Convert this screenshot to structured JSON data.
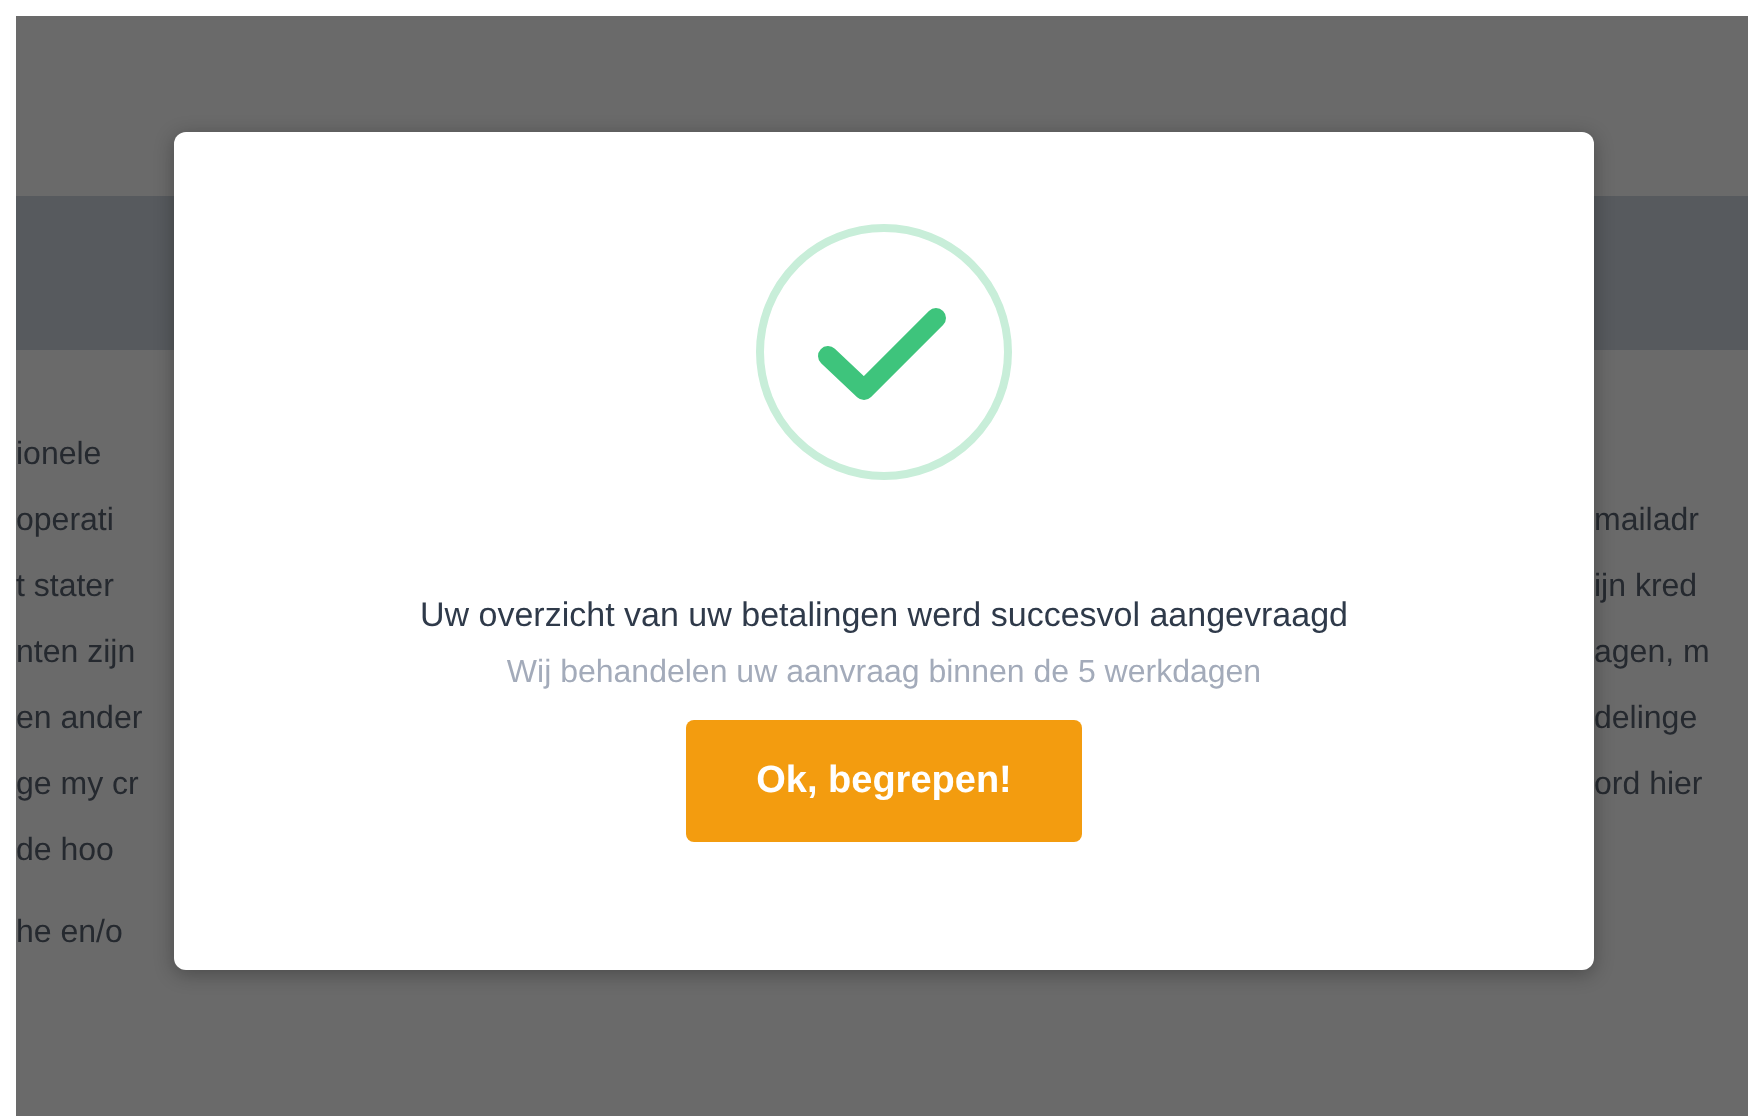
{
  "background_page": {
    "left_lines": [
      "ionele",
      "operati",
      "t stater",
      "nten zijn",
      "en ander",
      "ge my cr",
      "de hoo",
      "he en/o"
    ],
    "right_lines": [
      "mailadr",
      "ijn kred",
      "agen, m",
      "delinge",
      "ord hier"
    ]
  },
  "dialog": {
    "title": "Uw overzicht van uw betalingen werd succesvol aangevraagd",
    "message": "Wij behandelen uw aanvraag binnen de 5 werkdagen",
    "button": "Ok, begrepen!"
  }
}
